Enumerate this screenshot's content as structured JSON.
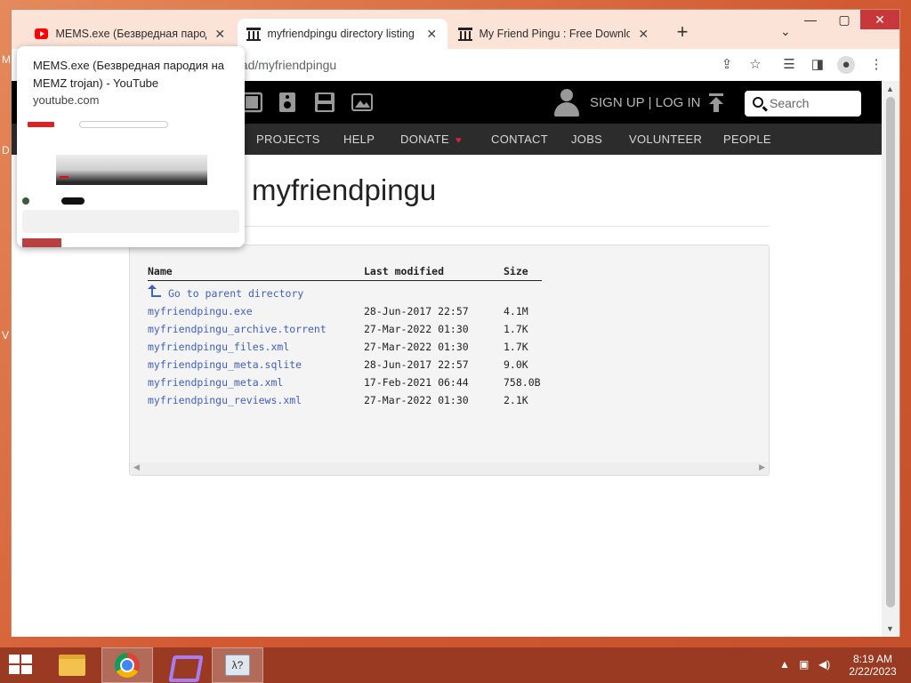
{
  "desktop": {
    "peek_letters": [
      "M",
      "D",
      "V"
    ]
  },
  "browser": {
    "tabs": [
      {
        "title": "MEMS.exe (Безвредная пародия на MEMZ trojan) - YouTube",
        "favicon": "youtube-icon",
        "active": false
      },
      {
        "title": "myfriendpingu directory listing",
        "favicon": "internet-archive-icon",
        "active": true
      },
      {
        "title": "My Friend Pingu : Free Download, Borrow",
        "favicon": "internet-archive-icon",
        "active": false
      }
    ],
    "url_visible": "oad/myfriendpingu",
    "window_buttons": {
      "minimize": "—",
      "maximize": "▢",
      "close": "✕"
    }
  },
  "tooltip": {
    "title": "MEMS.exe (Безвредная пародия на MEMZ trojan) - YouTube",
    "domain": "youtube.com"
  },
  "archive_header": {
    "account": "SIGN UP | LOG IN",
    "search_placeholder": "Search",
    "nav": [
      "PROJECTS",
      "HELP",
      "DONATE",
      "CONTACT",
      "JOBS",
      "VOLUNTEER",
      "PEOPLE"
    ],
    "donate_heart_color": "#e0203a"
  },
  "page": {
    "title": "myfriendpingu",
    "columns": {
      "name": "Name",
      "modified": "Last modified",
      "size": "Size"
    },
    "parent_link": "Go to parent directory",
    "files": [
      {
        "name": "myfriendpingu.exe",
        "modified": "28-Jun-2017 22:57",
        "size": "4.1M"
      },
      {
        "name": "myfriendpingu_archive.torrent",
        "modified": "27-Mar-2022 01:30",
        "size": "1.7K"
      },
      {
        "name": "myfriendpingu_files.xml",
        "modified": "27-Mar-2022 01:30",
        "size": "1.7K"
      },
      {
        "name": "myfriendpingu_meta.sqlite",
        "modified": "28-Jun-2017 22:57",
        "size": "9.0K"
      },
      {
        "name": "myfriendpingu_meta.xml",
        "modified": "17-Feb-2021 06:44",
        "size": "758.0B"
      },
      {
        "name": "myfriendpingu_reviews.xml",
        "modified": "27-Mar-2022 01:30",
        "size": "2.1K"
      }
    ]
  },
  "taskbar": {
    "time": "8:19 AM",
    "date": "2/22/2023"
  }
}
